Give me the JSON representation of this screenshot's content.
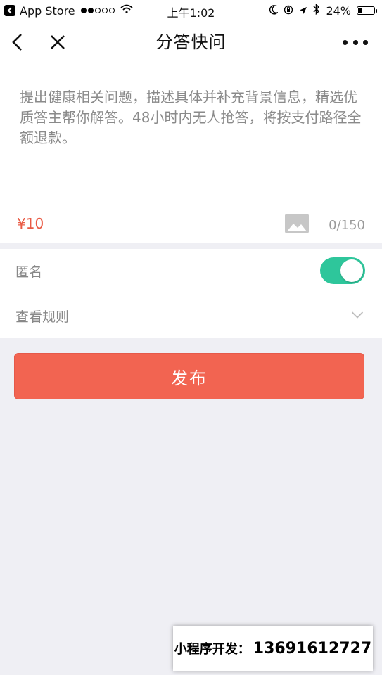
{
  "status_bar": {
    "back_app": "App Store",
    "time": "上午1:02",
    "battery": "24%",
    "battery_level": 0.24,
    "signal_bars_filled": 2,
    "signal_bars_total": 5
  },
  "nav": {
    "title": "分答快问"
  },
  "question": {
    "placeholder": "提出健康相关问题，描述具体并补充背景信息，精选优质答主帮你解答。48小时内无人抢答，将按支付路径全额退款。",
    "value": "",
    "price": "¥10",
    "char_count": "0/150"
  },
  "settings": {
    "anonymous_label": "匿名",
    "anonymous_on": true,
    "rules_label": "查看规则"
  },
  "actions": {
    "publish_label": "发布"
  },
  "watermark": {
    "label": "小程序开发：",
    "number": "13691612727"
  },
  "colors": {
    "accent": "#f26451",
    "price": "#e95b45",
    "toggle_on": "#2ec69b",
    "background": "#efeff4"
  }
}
